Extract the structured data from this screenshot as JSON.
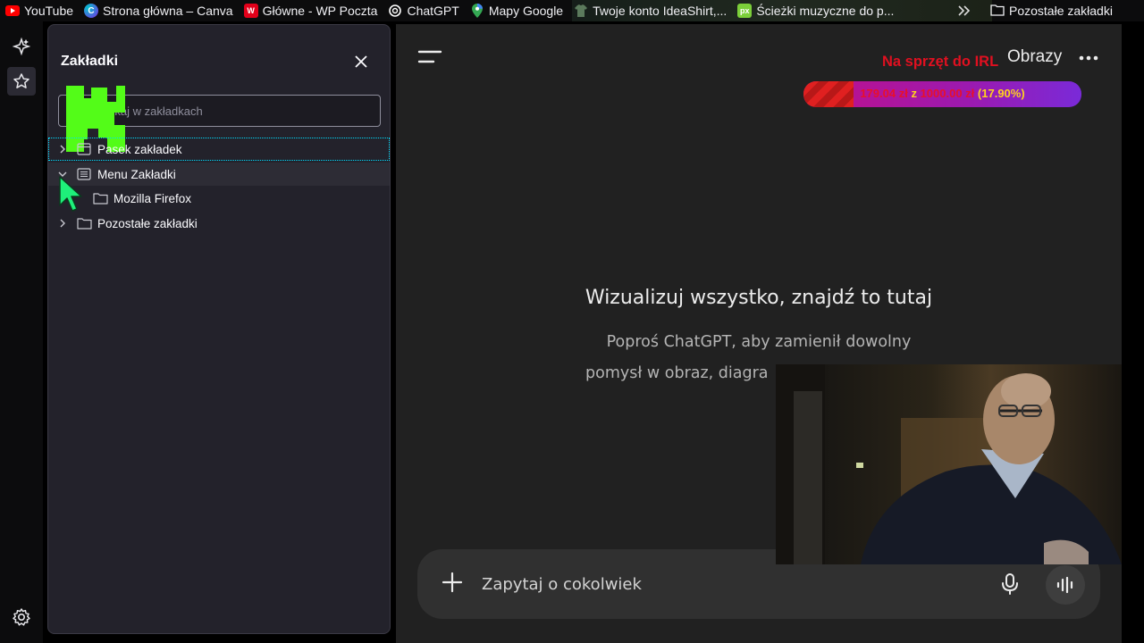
{
  "bookmarks_bar": {
    "items": [
      {
        "label": "YouTube",
        "icon": "youtube-icon",
        "color": "#ff0000"
      },
      {
        "label": "Strona główna – Canva",
        "icon": "canva-icon",
        "color": "#7d2ae8"
      },
      {
        "label": "Główne - WP Poczta",
        "icon": "wp-icon",
        "color": "#e2001a"
      },
      {
        "label": "ChatGPT",
        "icon": "openai-icon",
        "color": "#ffffff"
      },
      {
        "label": "Mapy Google",
        "icon": "maps-pin-icon",
        "color": "#34a853"
      },
      {
        "label": "Twoje konto IdeaShirt,...",
        "icon": "ideashirt-icon",
        "color": "#4a6a4a"
      },
      {
        "label": "Ścieżki muzyczne do p...",
        "icon": "px-icon",
        "color": "#7ccf3a"
      }
    ],
    "overflow_icon": "chevrons-right-icon",
    "other_bookmarks": "Pozostałe zakładki"
  },
  "sidebar": {
    "title": "Zakładki",
    "search_placeholder": "Szukaj w zakładkach",
    "tree": [
      {
        "label": "Pasek zakładek",
        "expanded": false
      },
      {
        "label": "Menu Zakładki",
        "expanded": true
      },
      {
        "label": "Mozilla Firefox",
        "child": true
      },
      {
        "label": "Pozostałe zakładki",
        "expanded": false
      }
    ]
  },
  "chat": {
    "header_label": "Obrazy",
    "title": "Wizualizuj wszystko, znajdź to tutaj",
    "subtitle_line1": "Poproś ChatGPT, aby zamienił dowolny",
    "subtitle_line2": "pomysł w obraz, diagra",
    "composer_placeholder": "Zapytaj o cokolwiek"
  },
  "overlay": {
    "goal_label": "Na sprzęt do IRL",
    "amount_current": "179.04 zł",
    "separator": "z",
    "amount_target": "1000.00 zł",
    "percent": "(17.90%)",
    "progress": 0.179,
    "colors": {
      "label": "#e01020",
      "fill": "#e02020",
      "bar": "#9b1ab0",
      "percent": "#ffd21e"
    }
  }
}
